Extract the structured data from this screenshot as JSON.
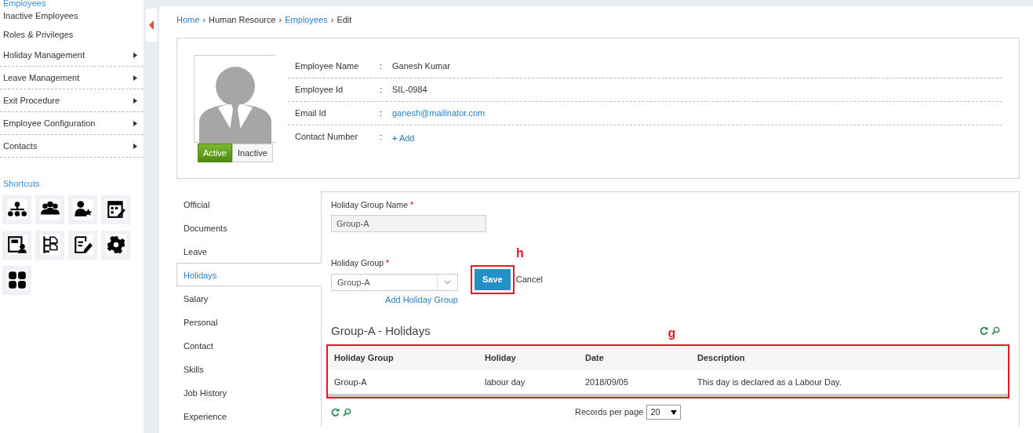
{
  "sidebar": {
    "heading": "Employees",
    "items": [
      {
        "label": "Inactive Employees",
        "kind": "link"
      },
      {
        "label": "Roles & Privileges",
        "kind": "link"
      },
      {
        "label": "Holiday Management",
        "kind": "menu"
      },
      {
        "label": "Leave Management",
        "kind": "menu"
      },
      {
        "label": "Exit Procedure",
        "kind": "menu"
      },
      {
        "label": "Employee Configuration",
        "kind": "menu"
      },
      {
        "label": "Contacts",
        "kind": "menu"
      }
    ],
    "shortcuts_title": "Shortcuts"
  },
  "breadcrumb": [
    {
      "label": "Home",
      "kind": "link"
    },
    {
      "separator": "›",
      "label": "Human Resource",
      "kind": "text"
    },
    {
      "separator": "›",
      "label": "Employees",
      "kind": "link"
    },
    {
      "separator": "›",
      "label": "Edit",
      "kind": "text"
    }
  ],
  "profile": {
    "status": [
      {
        "label": "Active",
        "selected": true
      },
      {
        "label": "Inactive",
        "selected": false
      }
    ],
    "fields": [
      {
        "label": "Employee Name",
        "colon": ":",
        "value": "Ganesh Kumar",
        "kind": "text"
      },
      {
        "label": "Employee Id",
        "colon": ":",
        "value": "SIL-0984",
        "kind": "text"
      },
      {
        "label": "Email Id",
        "colon": ":",
        "value": "ganesh@mailinator.com",
        "kind": "link"
      },
      {
        "label": "Contact Number",
        "colon": ":",
        "value": "Add",
        "icon": "+",
        "kind": "add"
      }
    ]
  },
  "tabs": [
    {
      "label": "Official",
      "selected": false
    },
    {
      "label": "Documents",
      "selected": false
    },
    {
      "label": "Leave",
      "selected": false
    },
    {
      "label": "Holidays",
      "selected": true
    },
    {
      "label": "Salary",
      "selected": false
    },
    {
      "label": "Personal",
      "selected": false
    },
    {
      "label": "Contact",
      "selected": false
    },
    {
      "label": "Skills",
      "selected": false
    },
    {
      "label": "Job History",
      "selected": false
    },
    {
      "label": "Experience",
      "selected": false
    }
  ],
  "form": {
    "group_name": {
      "label": "Holiday Group Name",
      "required": "*",
      "value": "Group-A",
      "disabled": true
    },
    "group": {
      "label": "Holiday Group",
      "required": "*",
      "value": "Group-A"
    },
    "add_link": "Add Holiday Group",
    "save": "Save",
    "cancel": "Cancel"
  },
  "table": {
    "title": "Group-A - Holidays",
    "columns": [
      "Holiday Group",
      "Holiday",
      "Date",
      "Description"
    ],
    "rows": [
      [
        "Group-A",
        "labour day",
        "2018/09/05",
        "This day is declared as a Labour Day."
      ]
    ],
    "records_label": "Records per page",
    "records_value": "20"
  },
  "annotations": [
    {
      "label": "h"
    },
    {
      "label": "g"
    }
  ]
}
